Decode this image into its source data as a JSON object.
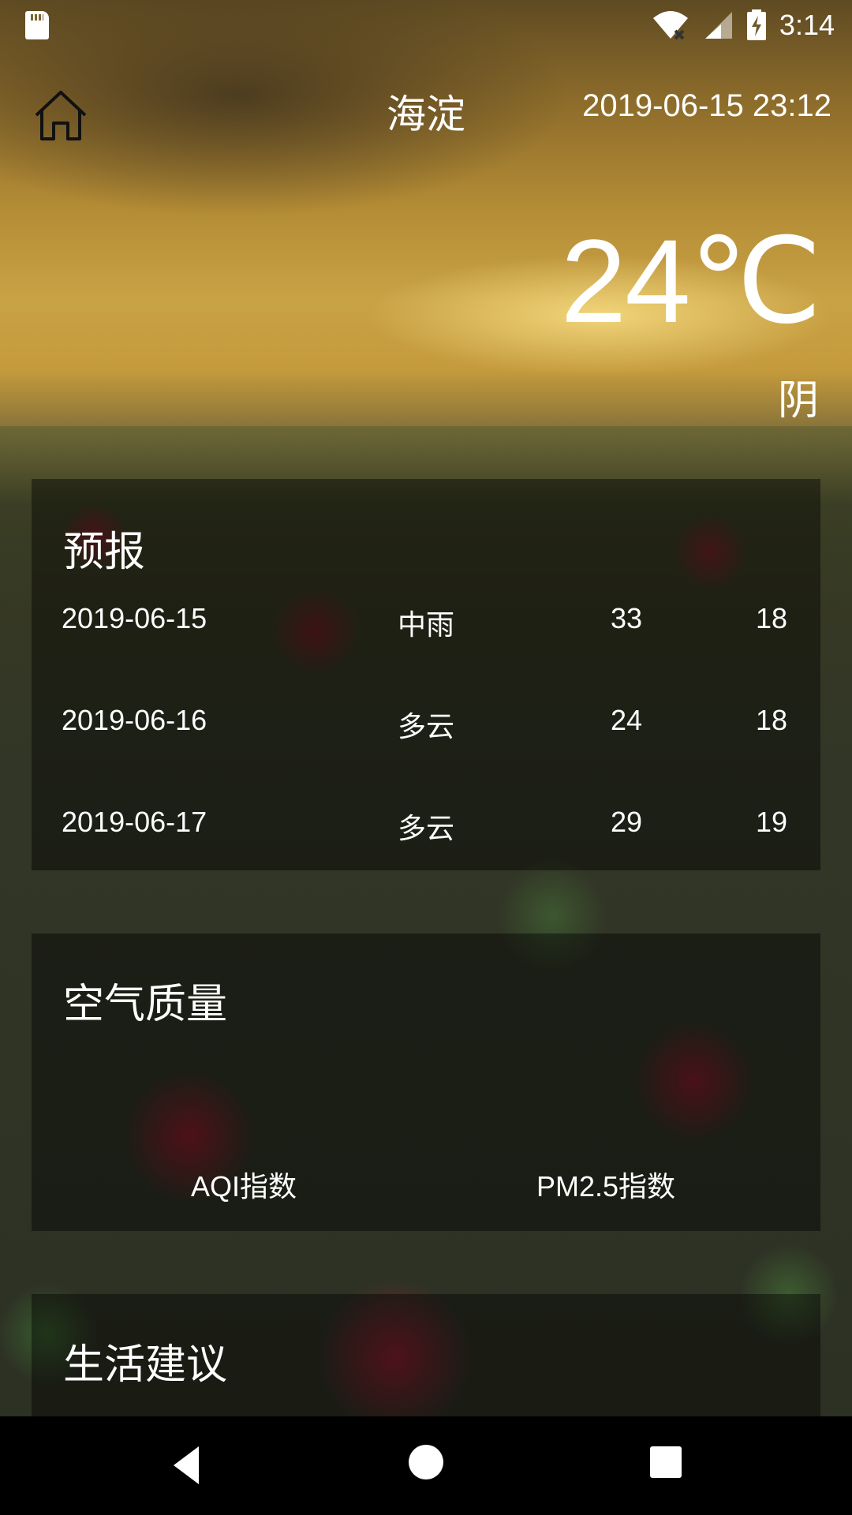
{
  "status_bar": {
    "time": "3:14",
    "icons": [
      "sd-card-icon",
      "wifi-off-icon",
      "signal-icon",
      "battery-charging-icon"
    ]
  },
  "header": {
    "city": "海淀",
    "update_time": "2019-06-15 23:12",
    "home_icon": "home-icon"
  },
  "now": {
    "temperature": "24℃",
    "condition": "阴"
  },
  "forecast": {
    "title": "预报",
    "days": [
      {
        "date": "2019-06-15",
        "condition": "中雨",
        "max": "33",
        "min": "18"
      },
      {
        "date": "2019-06-16",
        "condition": "多云",
        "max": "24",
        "min": "18"
      },
      {
        "date": "2019-06-17",
        "condition": "多云",
        "max": "29",
        "min": "19"
      }
    ]
  },
  "aqi": {
    "title": "空气质量",
    "aqi_label": "AQI指数",
    "pm25_label": "PM2.5指数"
  },
  "suggestion": {
    "title": "生活建议"
  },
  "nav_bar": {
    "icons": [
      "back-icon",
      "home-circle-icon",
      "recent-apps-icon"
    ]
  }
}
